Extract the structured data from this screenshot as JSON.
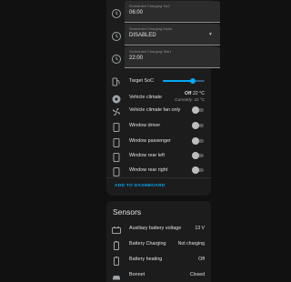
{
  "controls": {
    "schedule_soc": {
      "label": "Scheduled Charging SoC",
      "value": "06:00"
    },
    "schedule_mode": {
      "label": "Scheduled Charging Mode",
      "value": "DISABLED"
    },
    "schedule_start": {
      "label": "Scheduled Charging Start",
      "value": "22:00"
    },
    "target_soc": {
      "label": "Target SoC",
      "fraction": 0.72
    },
    "climate": {
      "label": "Vehicle climate",
      "state": "Off",
      "setpoint": "22 °C",
      "current": "Currently: 22 °C"
    },
    "climate_fan": {
      "label": "Vehicle climate fan only"
    },
    "window_driver": {
      "label": "Window driver"
    },
    "window_passenger": {
      "label": "Window passenger"
    },
    "window_rear_left": {
      "label": "Window rear left"
    },
    "window_rear_right": {
      "label": "Window rear right"
    },
    "add_to_dashboard": "ADD TO DASHBOARD"
  },
  "sensors": {
    "title": "Sensors",
    "aux_battery": {
      "label": "Auxiliary battery voltage",
      "value": "13 V"
    },
    "battery_charging": {
      "label": "Battery Charging",
      "value": "Not charging"
    },
    "battery_heating": {
      "label": "Battery heating",
      "value": "Off"
    },
    "bonnet": {
      "label": "Bonnet",
      "value": "Closed"
    }
  },
  "colors": {
    "accent": "#03a9f4",
    "card": "#1c1c1c",
    "background": "#111111"
  },
  "icons": [
    "clock-icon",
    "ev-station-icon",
    "fan-icon",
    "phone-icon",
    "battery-icon",
    "car-icon"
  ]
}
